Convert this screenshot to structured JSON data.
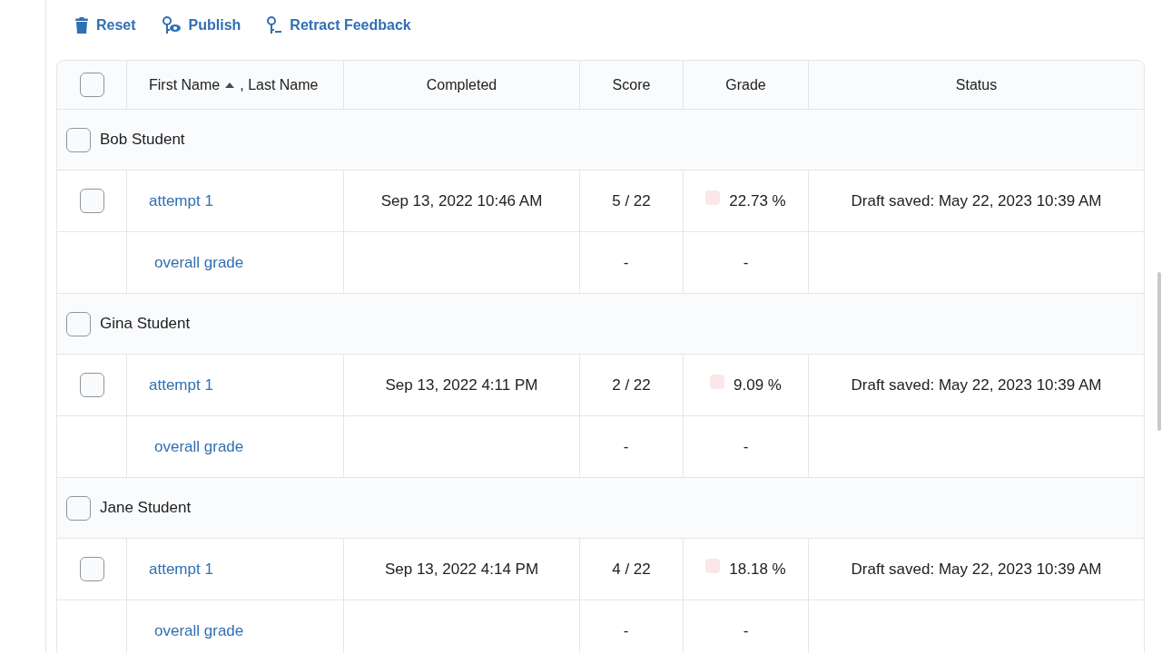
{
  "toolbar": [
    {
      "kind": "trash",
      "label": "Reset"
    },
    {
      "kind": "publish",
      "label": "Publish"
    },
    {
      "kind": "retract",
      "label": "Retract Feedback"
    }
  ],
  "table": {
    "select_all": false,
    "name_column": {
      "label": "First Name",
      "sorted_ascending": true,
      "secondary": ", Last Name"
    },
    "columns": [
      "Completed",
      "Score",
      "Grade",
      "Status"
    ],
    "students": [
      {
        "name": "Bob Student",
        "selected": false,
        "attempt": {
          "label": "attempt 1",
          "selected": false,
          "completed": "Sep 13, 2022 10:46 AM",
          "score": "5 / 22",
          "grade": "22.73 %",
          "status": "Draft saved: May 22, 2023 10:39 AM"
        },
        "overall": {
          "label": "overall grade",
          "score": "-",
          "grade": "-"
        }
      },
      {
        "name": "Gina Student",
        "selected": false,
        "attempt": {
          "label": "attempt 1",
          "selected": false,
          "completed": "Sep 13, 2022 4:11 PM",
          "score": "2 / 22",
          "grade": "9.09 %",
          "status": "Draft saved: May 22, 2023 10:39 AM"
        },
        "overall": {
          "label": "overall grade",
          "score": "-",
          "grade": "-"
        }
      },
      {
        "name": "Jane Student",
        "selected": false,
        "attempt": {
          "label": "attempt 1",
          "selected": false,
          "completed": "Sep 13, 2022 4:14 PM",
          "score": "4 / 22",
          "grade": "18.18 %",
          "status": "Draft saved: May 22, 2023 10:39 AM"
        },
        "overall": {
          "label": "overall grade",
          "score": "-",
          "grade": "-"
        }
      }
    ]
  }
}
